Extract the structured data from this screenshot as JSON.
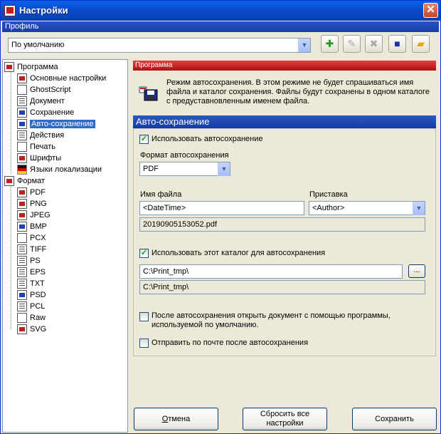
{
  "window": {
    "title": "Настройки",
    "close_glyph": "✕"
  },
  "profile": {
    "header": "Профиль",
    "selected": "По умолчанию",
    "tools": [
      "add-profile-icon",
      "rename-profile-icon",
      "delete-profile-icon",
      "save-profile-icon",
      "open-profile-icon"
    ]
  },
  "tree": {
    "program": "Программа",
    "program_items": [
      "Основные настройки",
      "GhostScript",
      "Документ",
      "Сохранение",
      "Авто-сохранение",
      "Действия",
      "Печать",
      "Шрифты",
      "Языки локализации"
    ],
    "format": "Формат",
    "format_items": [
      "PDF",
      "PNG",
      "JPEG",
      "BMP",
      "PCX",
      "TIFF",
      "PS",
      "EPS",
      "TXT",
      "PSD",
      "PCL",
      "Raw",
      "SVG"
    ]
  },
  "program_header": "Программа",
  "info": {
    "text": "Режим автосохранения. В этом режиме не будет спрашиваться имя файла и каталог сохранения. Файлы будут сохранены в одном каталоге с предуставновленным именем файла."
  },
  "auto": {
    "header": "Авто-сохранение",
    "use_auto": "Использовать автосохранение",
    "format_label": "Формат автосохранения",
    "format_value": "PDF",
    "filename_label": "Имя файла",
    "filename_value": "<DateTime>",
    "prefix_label": "Приставка",
    "prefix_value": "<Author>",
    "filename_preview": "20190905153052.pdf",
    "use_dir": "Использовать этот каталог для автосохранения",
    "dir_value": "C:\\Print_tmp\\",
    "browse": "...",
    "dir_preview": "C:\\Print_tmp\\",
    "open_after": "После автосохранения открыть документ с помощью программы, используемой по умолчанию.",
    "send_mail": "Отправить по почте после автосохранения"
  },
  "buttons": {
    "cancel_first": "О",
    "cancel_rest": "тмена",
    "reset": "Сбросить все настройки",
    "save": "Сохранить"
  }
}
